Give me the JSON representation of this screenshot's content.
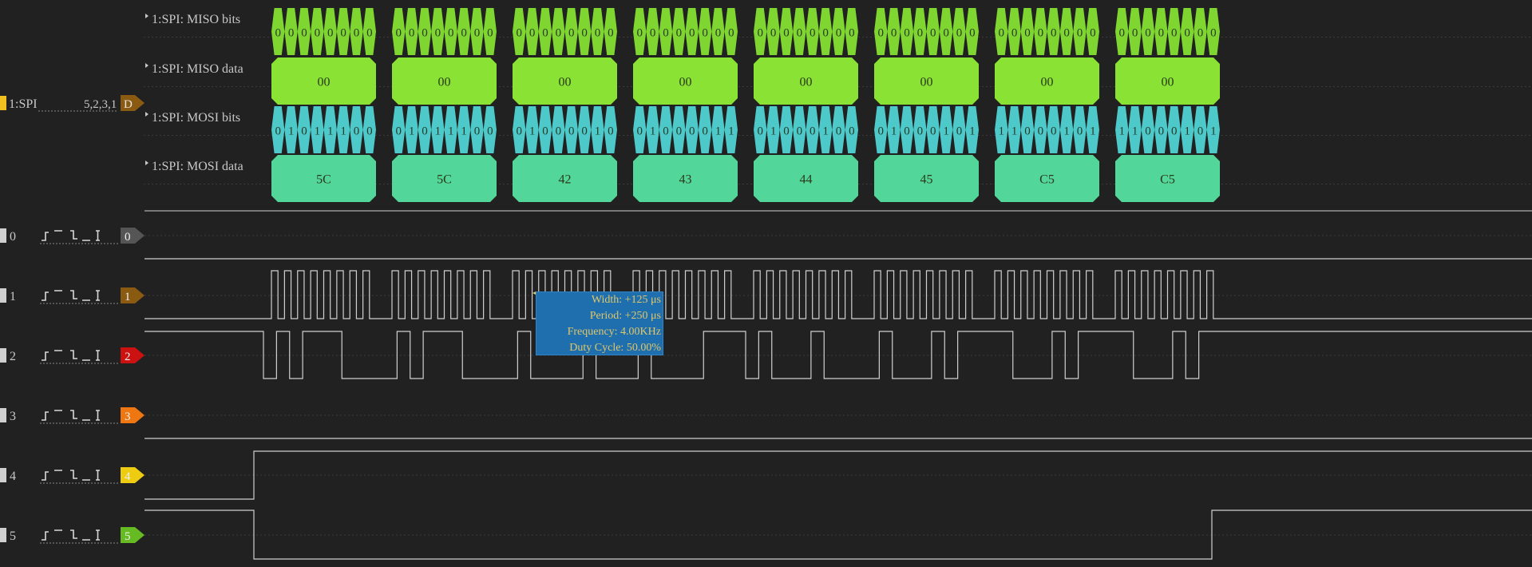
{
  "decoder": {
    "name": "1:SPI",
    "channels": "5,2,3,1",
    "badge": "D",
    "badge_color": "#8a5a10",
    "color_tag": "#f0c020",
    "rows": [
      {
        "label": "1:SPI: MISO bits",
        "kind": "bits",
        "color": "#7fd630",
        "frames": [
          "00000000",
          "00000000",
          "00000000",
          "00000000",
          "00000000",
          "00000000",
          "00000000",
          "00000000"
        ]
      },
      {
        "label": "1:SPI: MISO data",
        "kind": "data",
        "color": "#8ae234",
        "frames": [
          "00",
          "00",
          "00",
          "00",
          "00",
          "00",
          "00",
          "00"
        ]
      },
      {
        "label": "1:SPI: MOSI bits",
        "kind": "bits",
        "color": "#4ec9c9",
        "frames": [
          "01011100",
          "01011100",
          "01000010",
          "01000011",
          "01000100",
          "01000101",
          "11000101",
          "11000101"
        ]
      },
      {
        "label": "1:SPI: MOSI data",
        "kind": "data",
        "color": "#52d69a",
        "frames": [
          "5C",
          "5C",
          "42",
          "43",
          "44",
          "45",
          "C5",
          "C5"
        ]
      }
    ]
  },
  "channels": [
    {
      "id": "0",
      "label": "0",
      "badge": "0",
      "badge_color": "#555555"
    },
    {
      "id": "1",
      "label": "1",
      "badge": "1",
      "badge_color": "#8a5a10"
    },
    {
      "id": "2",
      "label": "2",
      "badge": "2",
      "badge_color": "#cc1111"
    },
    {
      "id": "3",
      "label": "3",
      "badge": "3",
      "badge_color": "#ee7711"
    },
    {
      "id": "4",
      "label": "4",
      "badge": "4",
      "badge_color": "#eecc11"
    },
    {
      "id": "5",
      "label": "5",
      "badge": "5",
      "badge_color": "#66bb22"
    }
  ],
  "measurement": {
    "width": "Width: +125 μs",
    "period": "Period: +250 μs",
    "frequency": "Frequency: 4.00KHz",
    "duty": "Duty Cycle: 50.00%"
  }
}
